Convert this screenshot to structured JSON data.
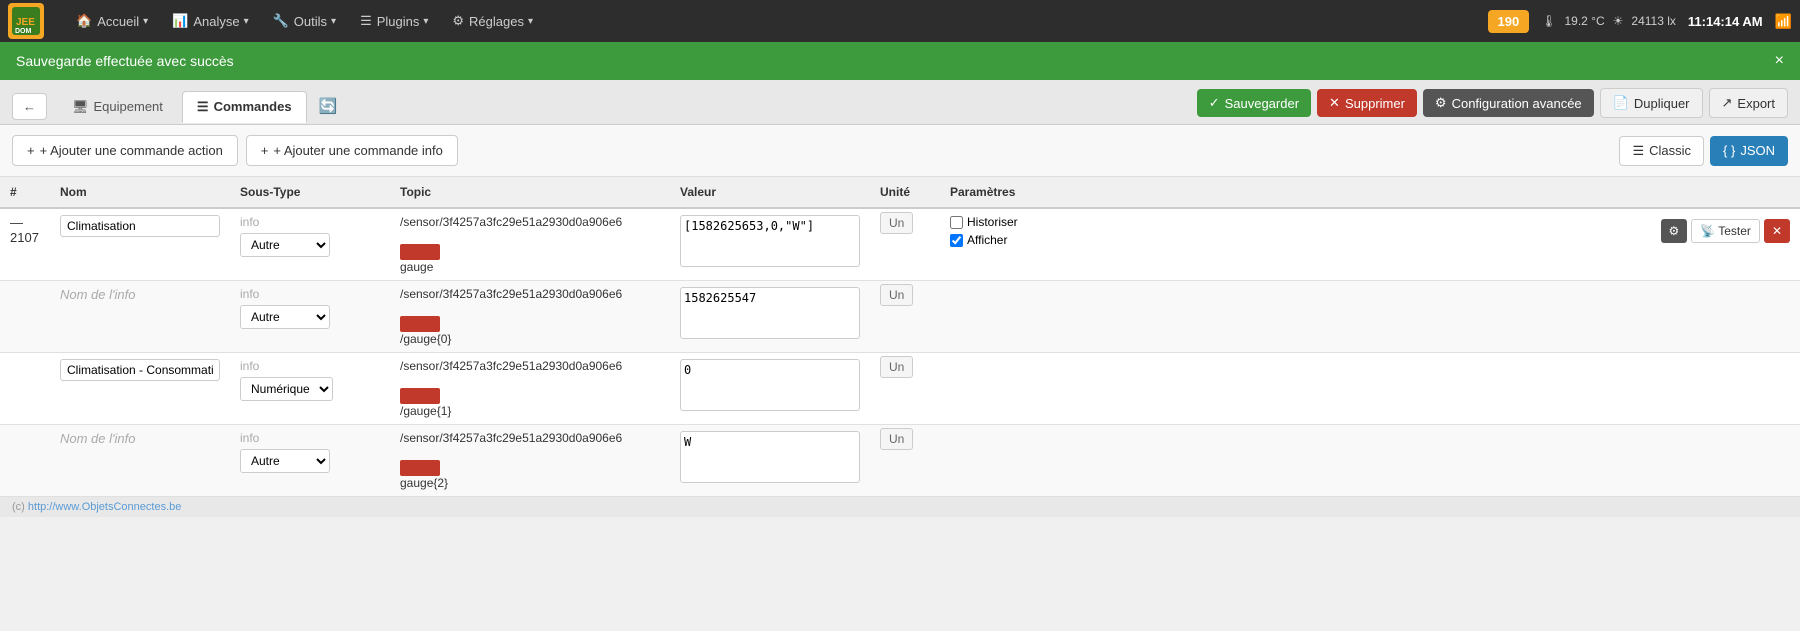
{
  "app": {
    "logo_letters": "JE",
    "logo_name_part1": "JEE",
    "logo_name_part2": "DOM"
  },
  "topnav": {
    "items": [
      {
        "label": "Accueil",
        "icon": "🏠"
      },
      {
        "label": "Analyse",
        "icon": "📊"
      },
      {
        "label": "Outils",
        "icon": "🔧"
      },
      {
        "label": "Plugins",
        "icon": "☰"
      },
      {
        "label": "Réglages",
        "icon": "⚙"
      }
    ],
    "badge": "190",
    "temperature": "19.2 °C",
    "light": "24113 lx",
    "time": "11:14:14 AM"
  },
  "success_bar": {
    "message": "Sauvegarde effectuée avec succès",
    "close": "×"
  },
  "tabs": {
    "back_icon": "←",
    "items": [
      {
        "label": "Equipement",
        "icon": "🖥",
        "active": false
      },
      {
        "label": "Commandes",
        "icon": "☰",
        "active": true
      }
    ],
    "refresh_icon": "🔄",
    "buttons": [
      {
        "label": "Sauvegarder",
        "icon": "✓",
        "type": "green"
      },
      {
        "label": "Supprimer",
        "icon": "✕",
        "type": "red"
      },
      {
        "label": "Configuration avancée",
        "icon": "⚙",
        "type": "gray"
      },
      {
        "label": "Dupliquer",
        "icon": "📄",
        "type": "light"
      },
      {
        "label": "Export",
        "icon": "↗",
        "type": "light"
      }
    ]
  },
  "actions": {
    "add_action_label": "+ Ajouter une commande action",
    "add_info_label": "+ Ajouter une commande info",
    "view_classic": "Classic",
    "view_json": "JSON"
  },
  "table": {
    "headers": [
      "#",
      "Nom",
      "Sous-Type",
      "Topic",
      "Valeur",
      "Unité",
      "Paramètres"
    ],
    "rows": [
      {
        "id": "2107",
        "id_prefix": "—",
        "name": "Climatisation",
        "sous_type_label": "info",
        "sous_type_select": "Autre",
        "topic_path": "/sensor/3f4257a3fc29e51a2930d0a906e6",
        "topic_suffix": "gauge",
        "valeur": "[1582625653,0,\"W\"]",
        "unite": "Un",
        "params": {
          "historiser_checked": false,
          "afficher_checked": true,
          "historiser_label": "Historiser",
          "afficher_label": "Afficher",
          "gear_label": "⚙",
          "tester_label": "Tester",
          "delete_label": "✕"
        }
      },
      {
        "id": "",
        "id_prefix": "",
        "name": "Nom de l'info",
        "name_placeholder": true,
        "sous_type_label": "info",
        "sous_type_select": "Autre",
        "topic_path": "/sensor/3f4257a3fc29e51a2930d0a906e6",
        "topic_suffix": "/gauge{0}",
        "valeur": "1582625547",
        "unite": "Un",
        "params": {}
      },
      {
        "id": "",
        "id_prefix": "",
        "name": "Climatisation - Consommation instantanée",
        "name_placeholder": false,
        "sous_type_label": "info",
        "sous_type_select": "Numérique",
        "topic_path": "/sensor/3f4257a3fc29e51a2930d0a906e6",
        "topic_suffix": "/gauge{1}",
        "valeur": "0",
        "unite": "Un",
        "params": {}
      },
      {
        "id": "",
        "id_prefix": "",
        "name": "Nom de l'info",
        "name_placeholder": true,
        "sous_type_label": "info",
        "sous_type_select": "Autre",
        "topic_path": "/sensor/3f4257a3fc29e51a2930d0a906e6",
        "topic_suffix": "gauge{2}",
        "valeur": "W",
        "unite": "Un",
        "params": {}
      }
    ]
  },
  "footer": {
    "text": "(c) http://www.ObjetsConnectes.be"
  }
}
